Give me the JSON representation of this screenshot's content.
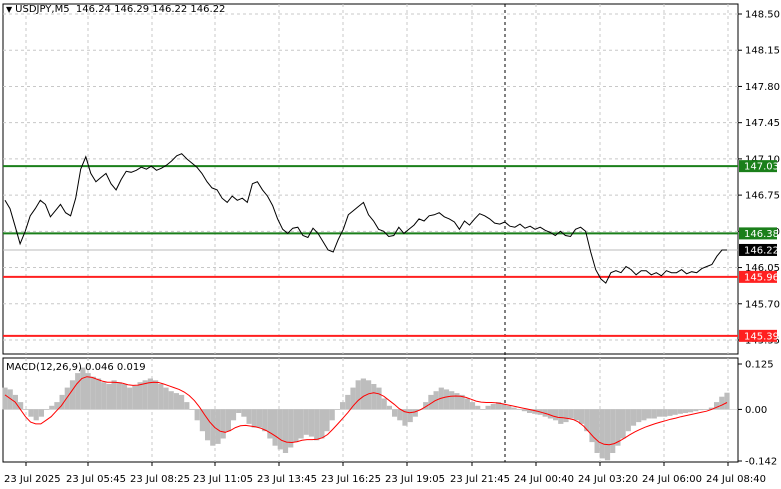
{
  "header": {
    "symbol": "USDJPY,M5",
    "ohlc": "146.24 146.29 146.22 146.22"
  },
  "macd": {
    "label": "MACD(12,26,9) 0.046 0.019",
    "axis": [
      "0.125",
      "0.00",
      "-0.142"
    ]
  },
  "price_axis": [
    "148.50",
    "148.15",
    "147.80",
    "147.45",
    "147.10",
    "146.75",
    "146.40",
    "146.05",
    "145.70",
    "145.35"
  ],
  "time_axis": [
    "23 Jul 2025",
    "23 Jul 05:45",
    "23 Jul 08:25",
    "23 Jul 11:05",
    "23 Jul 13:45",
    "23 Jul 16:25",
    "23 Jul 19:05",
    "23 Jul 21:45",
    "24 Jul 00:40",
    "24 Jul 03:20",
    "24 Jul 06:00",
    "24 Jul 08:40"
  ],
  "levels": [
    {
      "label": "147.03",
      "price": 147.03,
      "color": "#1a7f1a"
    },
    {
      "label": "146.38",
      "price": 146.38,
      "color": "#1a7f1a"
    },
    {
      "label": "145.96",
      "price": 145.96,
      "color": "#ff2020"
    },
    {
      "label": "145.39",
      "price": 145.39,
      "color": "#ff2020"
    }
  ],
  "current_price": {
    "label": "146.22",
    "price": 146.22
  },
  "colors": {
    "price_line": "#000000",
    "grid": "#c8c8c8",
    "macd_hist": "#bdbdbd",
    "signal": "#ff0000"
  },
  "chart_data": {
    "type": "line",
    "price_series": [
      146.7,
      146.62,
      146.45,
      146.28,
      146.4,
      146.55,
      146.62,
      146.7,
      146.66,
      146.54,
      146.6,
      146.66,
      146.58,
      146.55,
      146.72,
      147.0,
      147.12,
      146.96,
      146.88,
      146.92,
      146.96,
      146.86,
      146.8,
      146.9,
      146.98,
      146.97,
      146.99,
      147.02,
      147.0,
      147.03,
      146.99,
      147.01,
      147.04,
      147.08,
      147.13,
      147.15,
      147.1,
      147.06,
      147.02,
      146.96,
      146.88,
      146.82,
      146.8,
      146.72,
      146.68,
      146.74,
      146.7,
      146.72,
      146.68,
      146.86,
      146.88,
      146.8,
      146.74,
      146.65,
      146.52,
      146.42,
      146.38,
      146.43,
      146.44,
      146.36,
      146.34,
      146.43,
      146.38,
      146.3,
      146.22,
      146.2,
      146.32,
      146.42,
      146.56,
      146.6,
      146.64,
      146.68,
      146.56,
      146.5,
      146.42,
      146.4,
      146.35,
      146.36,
      146.44,
      146.38,
      146.42,
      146.46,
      146.52,
      146.5,
      146.55,
      146.56,
      146.58,
      146.54,
      146.52,
      146.49,
      146.42,
      146.5,
      146.46,
      146.52,
      146.57,
      146.55,
      146.52,
      146.48,
      146.47,
      146.49,
      146.45,
      146.44,
      146.47,
      146.43,
      146.45,
      146.42,
      146.44,
      146.41,
      146.39,
      146.36,
      146.4,
      146.36,
      146.35,
      146.42,
      146.44,
      146.4,
      146.2,
      146.03,
      145.94,
      145.9,
      146.0,
      146.02,
      146.0,
      146.06,
      146.03,
      145.98,
      146.02,
      146.02,
      145.98,
      146.0,
      145.97,
      146.02,
      146.0,
      146.0,
      146.03,
      145.99,
      146.01,
      146.0,
      146.04,
      146.06,
      146.08,
      146.16,
      146.22,
      146.22
    ],
    "macd_hist": [
      0.06,
      0.055,
      0.04,
      0.02,
      0.0,
      -0.02,
      -0.03,
      -0.02,
      0.0,
      0.01,
      0.02,
      0.04,
      0.06,
      0.08,
      0.1,
      0.115,
      0.1,
      0.09,
      0.085,
      0.075,
      0.07,
      0.08,
      0.075,
      0.07,
      0.06,
      0.065,
      0.075,
      0.08,
      0.085,
      0.08,
      0.07,
      0.06,
      0.05,
      0.045,
      0.04,
      0.02,
      0.0,
      -0.03,
      -0.06,
      -0.085,
      -0.1,
      -0.095,
      -0.08,
      -0.06,
      -0.03,
      -0.01,
      -0.02,
      -0.04,
      -0.05,
      -0.05,
      -0.06,
      -0.08,
      -0.1,
      -0.11,
      -0.12,
      -0.105,
      -0.09,
      -0.08,
      -0.07,
      -0.075,
      -0.085,
      -0.08,
      -0.06,
      -0.03,
      0.0,
      0.02,
      0.04,
      0.06,
      0.08,
      0.085,
      0.08,
      0.07,
      0.06,
      0.03,
      0.01,
      -0.02,
      -0.03,
      -0.045,
      -0.035,
      -0.02,
      0.0,
      0.02,
      0.04,
      0.05,
      0.06,
      0.055,
      0.05,
      0.045,
      0.04,
      0.03,
      0.02,
      0.01,
      0.0,
      0.01,
      0.015,
      0.02,
      0.015,
      0.01,
      0.005,
      0.0,
      -0.005,
      -0.01,
      -0.012,
      -0.015,
      -0.02,
      -0.025,
      -0.03,
      -0.04,
      -0.035,
      -0.025,
      -0.03,
      -0.04,
      -0.06,
      -0.09,
      -0.12,
      -0.135,
      -0.14,
      -0.12,
      -0.1,
      -0.08,
      -0.06,
      -0.045,
      -0.035,
      -0.03,
      -0.025,
      -0.025,
      -0.02,
      -0.02,
      -0.018,
      -0.015,
      -0.012,
      -0.01,
      -0.008,
      -0.005,
      -0.002,
      0.0,
      0.005,
      0.02,
      0.035,
      0.046
    ],
    "macd_signal": [
      0.04,
      0.03,
      0.02,
      0.0,
      -0.02,
      -0.035,
      -0.04,
      -0.04,
      -0.03,
      -0.02,
      -0.005,
      0.01,
      0.03,
      0.05,
      0.07,
      0.085,
      0.09,
      0.088,
      0.083,
      0.078,
      0.075,
      0.075,
      0.074,
      0.072,
      0.068,
      0.066,
      0.067,
      0.07,
      0.073,
      0.075,
      0.074,
      0.07,
      0.065,
      0.06,
      0.055,
      0.048,
      0.038,
      0.024,
      0.006,
      -0.015,
      -0.035,
      -0.05,
      -0.06,
      -0.063,
      -0.058,
      -0.05,
      -0.045,
      -0.044,
      -0.046,
      -0.048,
      -0.052,
      -0.058,
      -0.066,
      -0.075,
      -0.085,
      -0.09,
      -0.091,
      -0.089,
      -0.085,
      -0.083,
      -0.083,
      -0.082,
      -0.078,
      -0.069,
      -0.055,
      -0.04,
      -0.024,
      -0.008,
      0.01,
      0.025,
      0.036,
      0.043,
      0.046,
      0.043,
      0.036,
      0.025,
      0.014,
      0.002,
      -0.006,
      -0.009,
      -0.007,
      -0.002,
      0.006,
      0.015,
      0.024,
      0.03,
      0.034,
      0.036,
      0.037,
      0.036,
      0.033,
      0.028,
      0.023,
      0.02,
      0.019,
      0.019,
      0.018,
      0.016,
      0.013,
      0.01,
      0.007,
      0.004,
      0.001,
      -0.002,
      -0.005,
      -0.009,
      -0.013,
      -0.018,
      -0.022,
      -0.023,
      -0.025,
      -0.028,
      -0.035,
      -0.046,
      -0.061,
      -0.077,
      -0.09,
      -0.096,
      -0.097,
      -0.094,
      -0.087,
      -0.079,
      -0.07,
      -0.062,
      -0.055,
      -0.049,
      -0.044,
      -0.039,
      -0.035,
      -0.031,
      -0.027,
      -0.024,
      -0.02,
      -0.017,
      -0.014,
      -0.011,
      -0.008,
      -0.005,
      0.0,
      0.006,
      0.012,
      0.019
    ]
  }
}
